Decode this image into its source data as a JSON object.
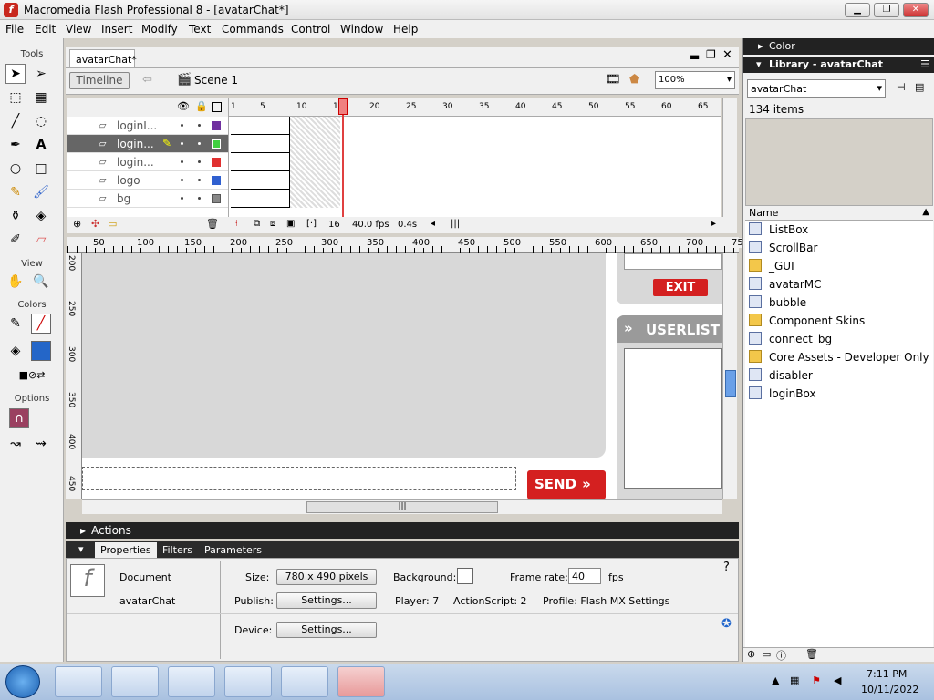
{
  "window": {
    "title": "Macromedia Flash Professional 8 - [avatarChat*]"
  },
  "menu": [
    "File",
    "Edit",
    "View",
    "Insert",
    "Modify",
    "Text",
    "Commands",
    "Control",
    "Window",
    "Help"
  ],
  "tools": {
    "label_tools": "Tools",
    "label_view": "View",
    "label_colors": "Colors",
    "label_options": "Options"
  },
  "document": {
    "tab": "avatarChat*",
    "timeline_button": "Timeline",
    "scene": "Scene 1",
    "zoom": "100%"
  },
  "layers": [
    {
      "name": "loginI..."
    },
    {
      "name": "login..."
    },
    {
      "name": "login..."
    },
    {
      "name": "logo"
    },
    {
      "name": "bg"
    }
  ],
  "timeline": {
    "frame_numbers": [
      "1",
      "5",
      "10",
      "15",
      "20",
      "25",
      "30",
      "35",
      "40",
      "45",
      "50",
      "55",
      "60",
      "65"
    ],
    "current_frame": "16",
    "fps": "40.0 fps",
    "time": "0.4s"
  },
  "ruler_top": [
    "50",
    "100",
    "150",
    "200",
    "250",
    "300",
    "350",
    "400",
    "450",
    "500",
    "550",
    "600",
    "650",
    "700",
    "75"
  ],
  "ruler_left": [
    "200",
    "250",
    "300",
    "350",
    "400",
    "450"
  ],
  "stage": {
    "exit": "EXIT",
    "userlist": "USERLIST",
    "send": "SEND"
  },
  "actions": {
    "label": "Actions"
  },
  "properties": {
    "tabs": [
      "Properties",
      "Filters",
      "Parameters"
    ],
    "doc_label": "Document",
    "doc_name": "avatarChat",
    "size_label": "Size:",
    "size_value": "780 x 490 pixels",
    "bg_label": "Background:",
    "framerate_label": "Frame rate:",
    "framerate_value": "40",
    "fps_unit": "fps",
    "publish_label": "Publish:",
    "settings_btn": "Settings...",
    "player": "Player: 7",
    "actionscript": "ActionScript: 2",
    "profile": "Profile: Flash MX Settings",
    "device_label": "Device:",
    "device_settings_btn": "Settings..."
  },
  "color_panel": {
    "title": "Color"
  },
  "library": {
    "title": "Library - avatarChat",
    "selected": "avatarChat",
    "count": "134 items",
    "col_name": "Name",
    "items": [
      {
        "name": "ListBox",
        "type": "component"
      },
      {
        "name": "ScrollBar",
        "type": "component"
      },
      {
        "name": "_GUI",
        "type": "folder"
      },
      {
        "name": "avatarMC",
        "type": "symbol"
      },
      {
        "name": "bubble",
        "type": "symbol"
      },
      {
        "name": "Component Skins",
        "type": "folder"
      },
      {
        "name": "connect_bg",
        "type": "symbol"
      },
      {
        "name": "Core Assets - Developer Only",
        "type": "folder"
      },
      {
        "name": "disabler",
        "type": "symbol"
      },
      {
        "name": "loginBox",
        "type": "symbol"
      }
    ]
  },
  "taskbar": {
    "time": "7:11 PM",
    "date": "10/11/2022"
  }
}
